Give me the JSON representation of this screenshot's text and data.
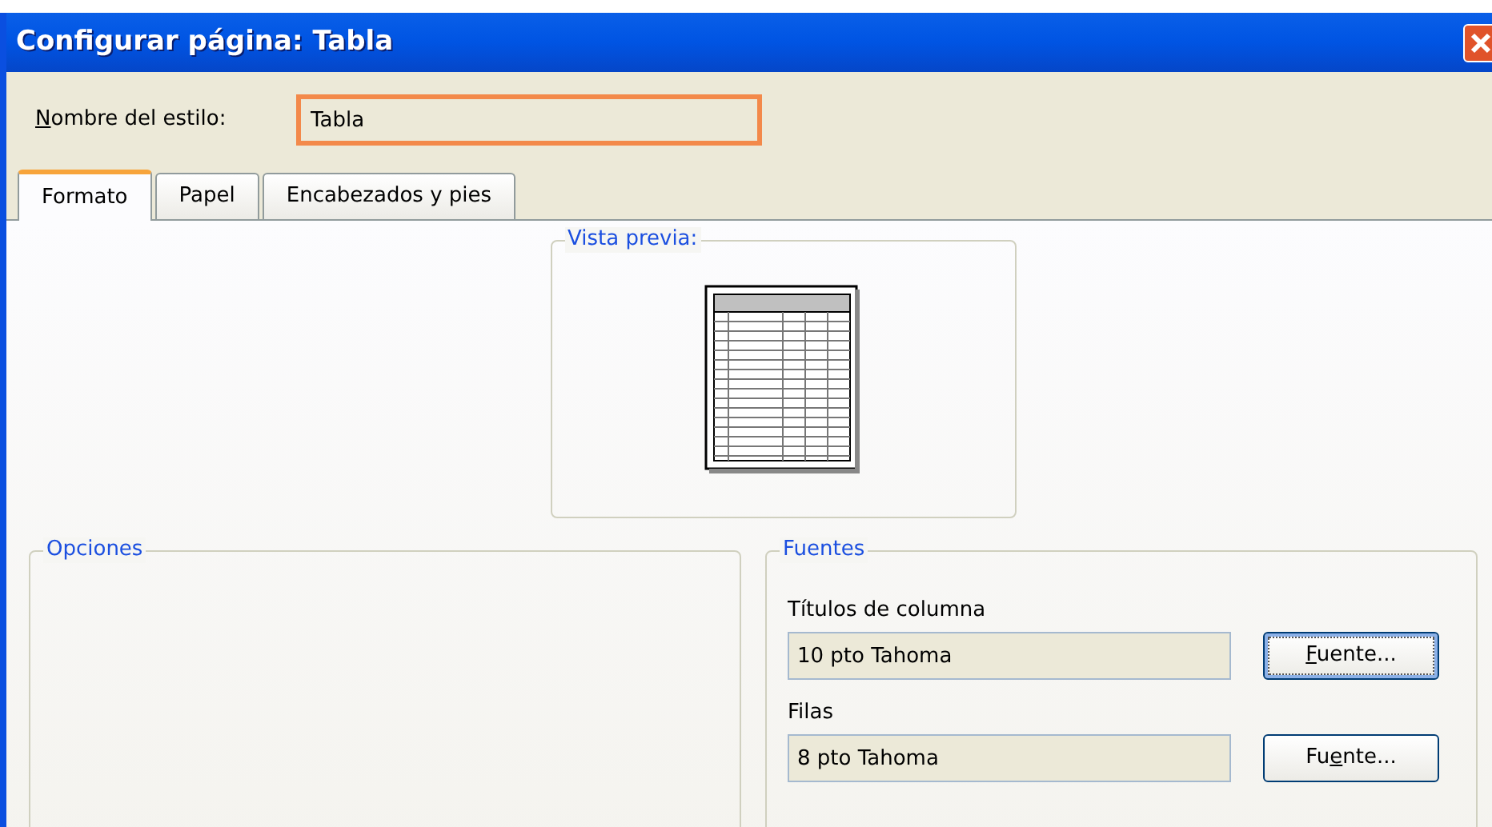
{
  "window": {
    "title": "Configurar página: Tabla"
  },
  "style_name": {
    "label": [
      {
        "text": "N",
        "underlined": true
      },
      {
        "text": "ombre del estilo:",
        "underlined": false
      }
    ],
    "value": "Tabla",
    "focused": true
  },
  "tabs": [
    {
      "label": "Formato",
      "selected": true
    },
    {
      "label": "Papel",
      "selected": false
    },
    {
      "label": "Encabezados y pies",
      "selected": false
    }
  ],
  "preview": {
    "title": "Vista previa:"
  },
  "options": {
    "title": "Opciones"
  },
  "fonts": {
    "title": "Fuentes",
    "rows": [
      {
        "label": "Títulos de columna",
        "value": "10 pto Tahoma",
        "button": [
          {
            "text": "F",
            "underlined": true
          },
          {
            "text": "uente...",
            "underlined": false
          }
        ],
        "focused": true
      },
      {
        "label": "Filas",
        "value": "8 pto Tahoma",
        "button": [
          {
            "text": "Fu",
            "underlined": false
          },
          {
            "text": "e",
            "underlined": true
          },
          {
            "text": "nte...",
            "underlined": false
          }
        ],
        "focused": false
      }
    ]
  }
}
